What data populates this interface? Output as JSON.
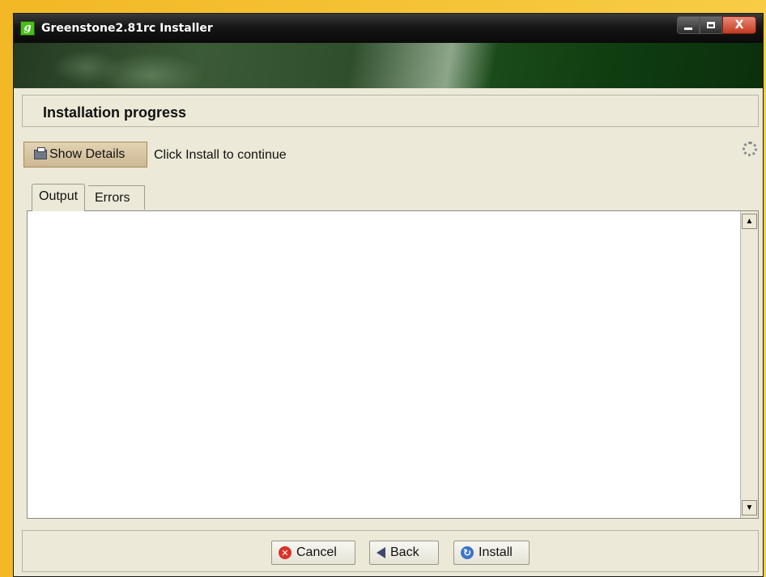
{
  "window": {
    "title": "Greenstone2.81rc Installer",
    "app_icon_glyph": "g",
    "close_glyph": "X"
  },
  "header": {
    "title": "Installation progress"
  },
  "details": {
    "button_label": "Show Details",
    "status": "Click Install to continue"
  },
  "tabs": [
    {
      "label": "Output",
      "active": true
    },
    {
      "label": "Errors",
      "active": false
    }
  ],
  "output": {
    "content": ""
  },
  "footer": {
    "cancel_label": "Cancel",
    "back_label": "Back",
    "install_label": "Install"
  },
  "icons": {
    "app": "greenstone-app-icon",
    "minimize": "minimize-icon",
    "maximize": "maximize-icon",
    "close": "close-icon",
    "details": "printer-icon",
    "busy": "spinner-icon",
    "cancel": "cancel-icon",
    "back": "back-arrow-icon",
    "install": "install-icon"
  },
  "colors": {
    "title_bar": "#0a0a0a",
    "window_bg": "#ece9d8",
    "desktop": "#f2b825"
  }
}
